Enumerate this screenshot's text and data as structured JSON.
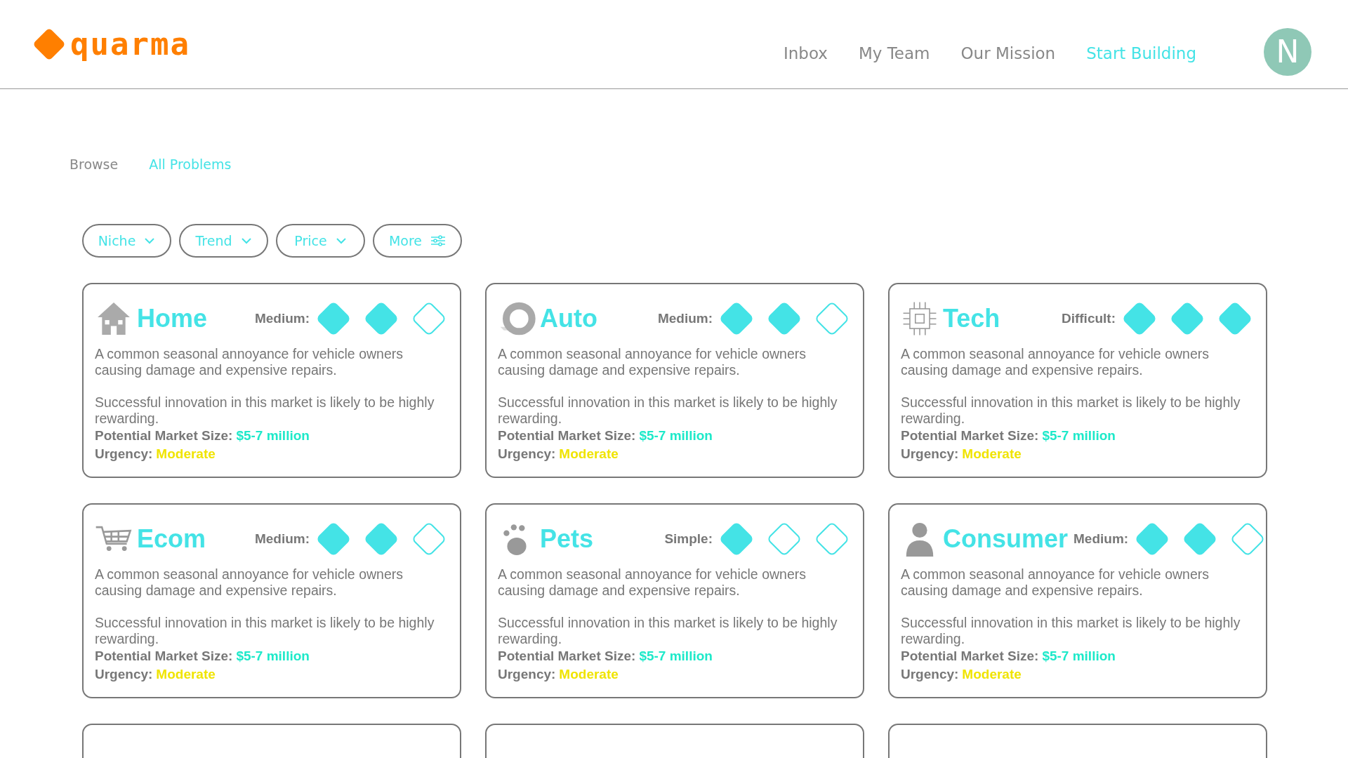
{
  "header": {
    "logo": "quarma",
    "nav": [
      {
        "label": "Inbox",
        "selected": false
      },
      {
        "label": "My Team",
        "selected": false
      },
      {
        "label": "Our Mission",
        "selected": false
      },
      {
        "label": "Start Building",
        "selected": true
      }
    ],
    "avatar": "N"
  },
  "breadcrumb": [
    {
      "label": "Browse",
      "selected": false
    },
    {
      "label": "All Problems",
      "selected": true
    }
  ],
  "filters": [
    {
      "label": "Niche",
      "kind": "dropdown"
    },
    {
      "label": "Trend",
      "kind": "dropdown"
    },
    {
      "label": "Price",
      "kind": "dropdown"
    },
    {
      "label": "More",
      "kind": "settings"
    }
  ],
  "cards": [
    {
      "kind": "house",
      "title": "Home",
      "difficulty": "Medium:",
      "stars": 2,
      "description": "A common seasonal annoyance for vehicle owners causing damage and expensive repairs.",
      "note": "Successful innovation in this market is likely to be highly rewarding.",
      "market_label": "Potential Market Size:",
      "market_value": "$5-7 million",
      "urgency_label": "Urgency:",
      "urgency_value": "Moderate"
    },
    {
      "kind": "tire",
      "title": "Auto",
      "difficulty": "Medium:",
      "stars": 2,
      "description": "A common seasonal annoyance for vehicle owners causing damage and expensive repairs.",
      "note": "Successful innovation in this market is likely to be highly rewarding.",
      "market_label": "Potential Market Size:",
      "market_value": "$5-7 million",
      "urgency_label": "Urgency:",
      "urgency_value": "Moderate"
    },
    {
      "kind": "chip",
      "title": "Tech",
      "difficulty": "Difficult:",
      "stars": 3,
      "description": "A common seasonal annoyance for vehicle owners causing damage and expensive repairs.",
      "note": "Successful innovation in this market is likely to be highly rewarding.",
      "market_label": "Potential Market Size:",
      "market_value": "$5-7 million",
      "urgency_label": "Urgency:",
      "urgency_value": "Moderate"
    },
    {
      "kind": "cart",
      "title": "Ecom",
      "difficulty": "Medium:",
      "stars": 2,
      "description": "A common seasonal annoyance for vehicle owners causing damage and expensive repairs.",
      "note": "Successful innovation in this market is likely to be highly rewarding.",
      "market_label": "Potential Market Size:",
      "market_value": "$5-7 million",
      "urgency_label": "Urgency:",
      "urgency_value": "Moderate"
    },
    {
      "kind": "paw",
      "title": "Pets",
      "difficulty": "Simple:",
      "stars": 1,
      "description": "A common seasonal annoyance for vehicle owners causing damage and expensive repairs.",
      "note": "Successful innovation in this market is likely to be highly rewarding.",
      "market_label": "Potential Market Size:",
      "market_value": "$5-7 million",
      "urgency_label": "Urgency:",
      "urgency_value": "Moderate"
    },
    {
      "kind": "person",
      "title": "Consumer",
      "difficulty": "Medium:",
      "stars": 2,
      "description": "A common seasonal annoyance for vehicle owners causing damage and expensive repairs.",
      "note": "Successful innovation in this market is likely to be highly rewarding.",
      "market_label": "Potential Market Size:",
      "market_value": "$5-7 million",
      "urgency_label": "Urgency:",
      "urgency_value": "Moderate"
    },
    {
      "kind": "empty"
    },
    {
      "kind": "empty"
    },
    {
      "kind": "empty"
    }
  ]
}
